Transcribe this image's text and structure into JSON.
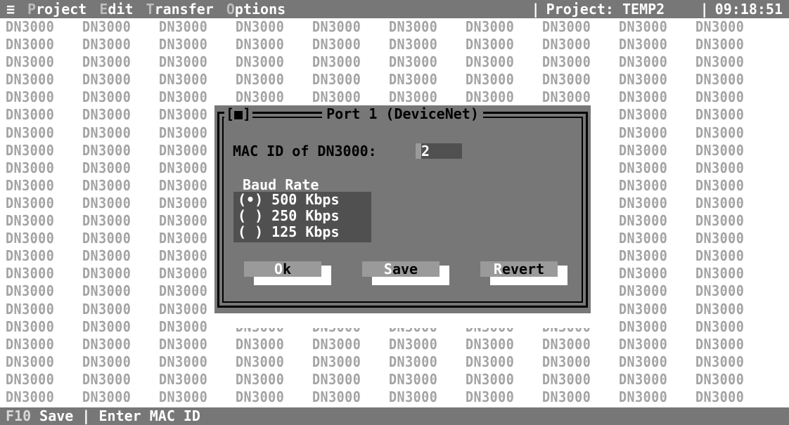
{
  "menubar": {
    "system_icon": "≡",
    "menus": [
      {
        "hot": "P",
        "rest": "roject"
      },
      {
        "hot": "E",
        "rest": "dit"
      },
      {
        "hot": "T",
        "rest": "ransfer"
      },
      {
        "hot": "O",
        "rest": "ptions"
      }
    ],
    "project_label": "Project: TEMP2",
    "clock": "09:18:51",
    "separator": "|"
  },
  "background": {
    "tile_text": "DN3000",
    "columns": 10,
    "rows": 22
  },
  "dialog": {
    "title": "Port 1 (DeviceNet)",
    "close_box": "[■]",
    "mac_label": "MAC ID of DN3000:",
    "mac_value": "2",
    "baud_label": "Baud Rate",
    "baud_options": [
      {
        "mark": "(•)",
        "label": "500 Kbps",
        "selected": true
      },
      {
        "mark": "( )",
        "label": "250 Kbps",
        "selected": false
      },
      {
        "mark": "( )",
        "label": "125 Kbps",
        "selected": false
      }
    ],
    "buttons": {
      "ok": {
        "hot": "O",
        "rest": "k"
      },
      "save": {
        "hot": "S",
        "rest": "ave"
      },
      "revert": {
        "hot": "R",
        "rest": "evert"
      }
    }
  },
  "statusbar": {
    "key": "F10",
    "key_action": "Save",
    "separator": "|",
    "hint": "Enter MAC ID"
  },
  "colors": {
    "bar": "#777777",
    "tile_text": "#a3a3a3",
    "dialog_bg": "#777777",
    "field_bg": "#505050",
    "button_face": "#9a9a9a"
  }
}
